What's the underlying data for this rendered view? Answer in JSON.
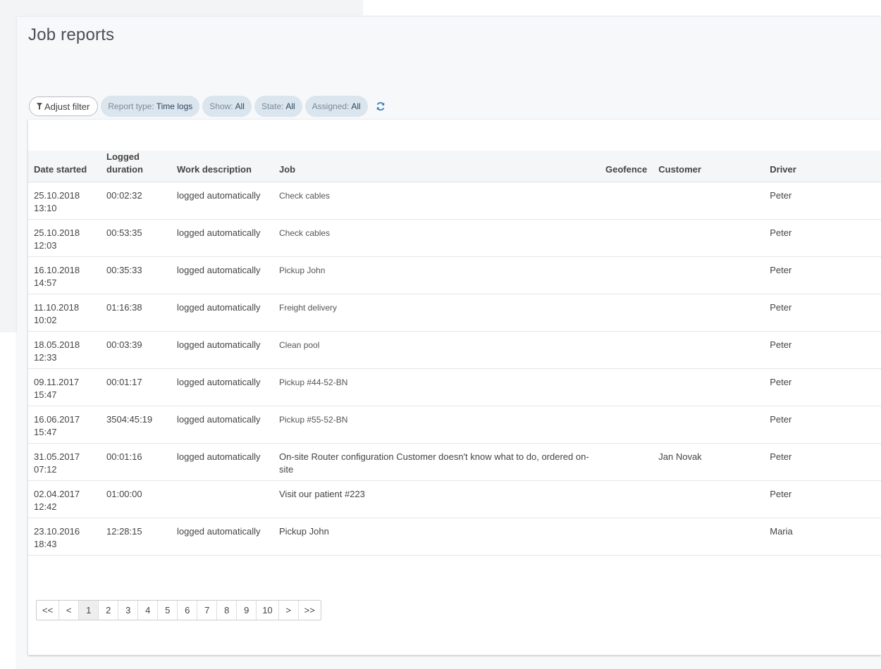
{
  "page": {
    "title": "Job reports"
  },
  "filters": {
    "adjust_label": "Adjust filter",
    "chips": [
      {
        "key": "Report type:",
        "value": "Time logs"
      },
      {
        "key": "Show:",
        "value": "All"
      },
      {
        "key": "State:",
        "value": "All"
      },
      {
        "key": "Assigned:",
        "value": "All"
      }
    ]
  },
  "icons": {
    "filter": "funnel-icon",
    "refresh": "refresh-icon"
  },
  "colors": {
    "chip_bg": "#dbe5ee",
    "chip_value": "#2c4660",
    "refresh": "#3a7bbf"
  },
  "table": {
    "columns": {
      "date": "Date started",
      "duration_line1": "Logged",
      "duration_line2": "duration",
      "work": "Work description",
      "job": "Job",
      "geofence": "Geofence",
      "customer": "Customer",
      "driver": "Driver"
    },
    "rows": [
      {
        "date": "25.10.2018 13:10",
        "duration": "00:02:32",
        "work": "logged automatically",
        "job": "Check cables",
        "geofence": "",
        "customer": "",
        "driver": "Peter"
      },
      {
        "date": "25.10.2018 12:03",
        "duration": "00:53:35",
        "work": "logged automatically",
        "job": "Check cables",
        "geofence": "",
        "customer": "",
        "driver": "Peter"
      },
      {
        "date": "16.10.2018 14:57",
        "duration": "00:35:33",
        "work": "logged automatically",
        "job": "Pickup John",
        "geofence": "",
        "customer": "",
        "driver": "Peter"
      },
      {
        "date": "11.10.2018 10:02",
        "duration": "01:16:38",
        "work": "logged automatically",
        "job": "Freight delivery",
        "geofence": "",
        "customer": "",
        "driver": "Peter"
      },
      {
        "date": "18.05.2018 12:33",
        "duration": "00:03:39",
        "work": "logged automatically",
        "job": "Clean pool",
        "geofence": "",
        "customer": "",
        "driver": "Peter"
      },
      {
        "date": "09.11.2017 15:47",
        "duration": "00:01:17",
        "work": "logged automatically",
        "job": "Pickup #44-52-BN",
        "geofence": "",
        "customer": "",
        "driver": "Peter"
      },
      {
        "date": "16.06.2017 15:47",
        "duration": "3504:45:19",
        "work": "logged automatically",
        "job": "Pickup #55-52-BN",
        "geofence": "",
        "customer": "",
        "driver": "Peter"
      },
      {
        "date": "31.05.2017 07:12",
        "duration": "00:01:16",
        "work": "logged automatically",
        "job": "On-site Router configuration Customer doesn't know what to do, ordered on-site",
        "geofence": "",
        "customer": "Jan Novak",
        "driver": "Peter"
      },
      {
        "date": "02.04.2017 12:42",
        "duration": "01:00:00",
        "work": "",
        "job": "Visit our patient #223",
        "geofence": "",
        "customer": "",
        "driver": "Peter"
      },
      {
        "date": "23.10.2016 18:43",
        "duration": "12:28:15",
        "work": "logged automatically",
        "job": "Pickup John",
        "geofence": "",
        "customer": "",
        "driver": "Maria"
      }
    ]
  },
  "pagination": {
    "first": "<<",
    "prev": "<",
    "pages": [
      "1",
      "2",
      "3",
      "4",
      "5",
      "6",
      "7",
      "8",
      "9",
      "10"
    ],
    "current": "1",
    "next": ">",
    "last": ">>"
  }
}
